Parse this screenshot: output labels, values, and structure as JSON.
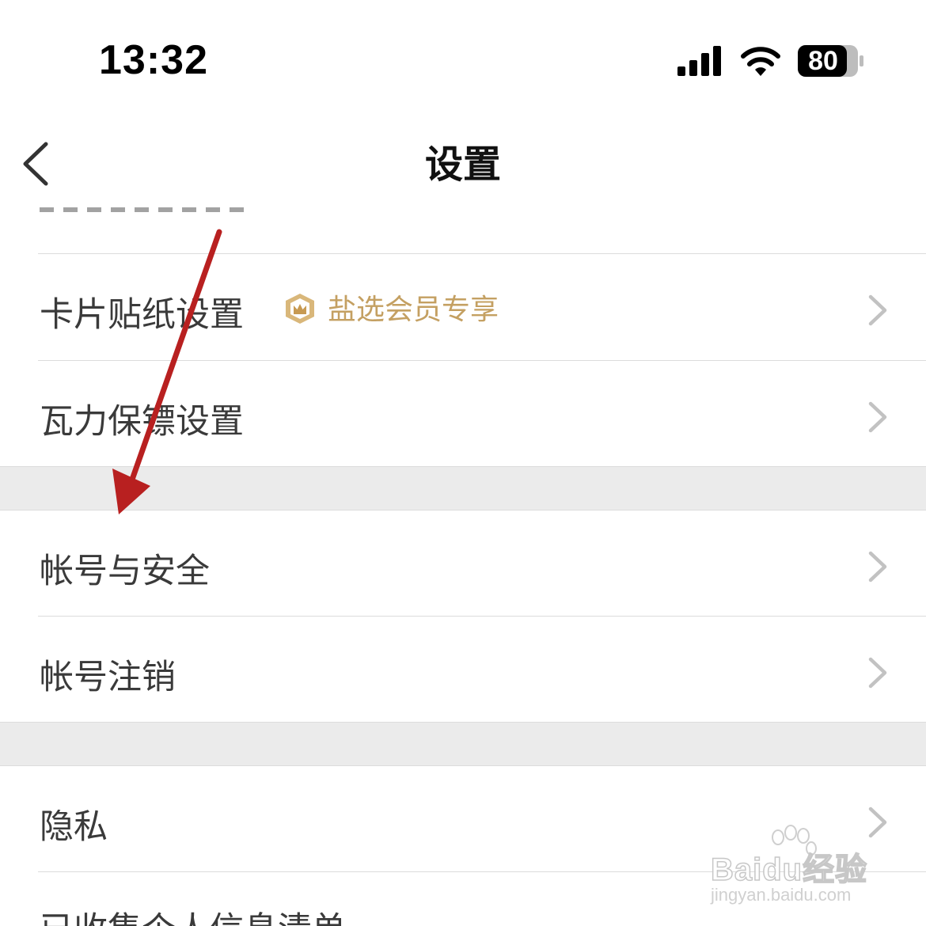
{
  "status_bar": {
    "time": "13:32",
    "battery_level": "80",
    "icons": [
      "cellular-signal-icon",
      "wifi-icon",
      "battery-icon"
    ]
  },
  "nav": {
    "title": "设置",
    "back_icon": "chevron-left-icon"
  },
  "list": {
    "sections": [
      {
        "items": [
          {
            "label": "卡片贴纸设置",
            "badge": {
              "icon": "crown-badge-icon",
              "text": "盐选会员专享"
            }
          },
          {
            "label": "瓦力保镖设置"
          }
        ]
      },
      {
        "items": [
          {
            "label": "帐号与安全"
          },
          {
            "label": "帐号注销"
          }
        ]
      },
      {
        "items": [
          {
            "label": "隐私"
          },
          {
            "label": "已收集个人信息清单"
          }
        ]
      }
    ]
  },
  "annotation": {
    "type": "red-arrow",
    "color": "#b82020"
  },
  "watermark": {
    "brand": "Baidu经验",
    "url": "jingyan.baidu.com"
  },
  "colors": {
    "badge_gold": "#c4a062",
    "separator_gray": "#ebebeb",
    "text": "#3a3a3a",
    "chevron": "#c2c2c2"
  }
}
